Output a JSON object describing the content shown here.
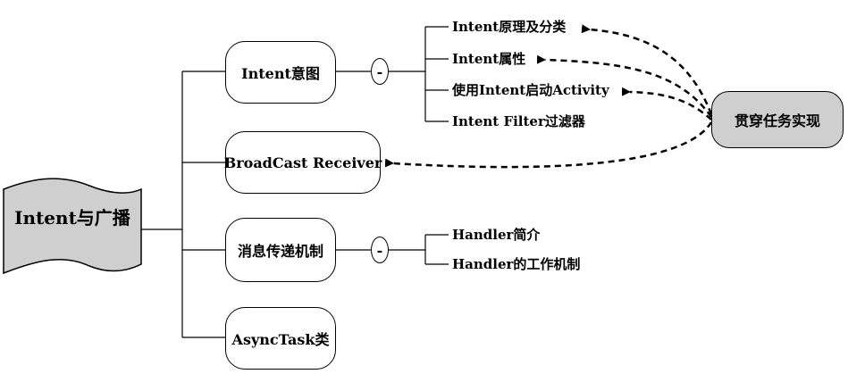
{
  "root": {
    "label": "Intent与广播"
  },
  "branches": [
    {
      "label": "Intent意图",
      "children": [
        "Intent原理及分类",
        "Intent属性",
        "使用Intent启动Activity",
        "Intent Filter过滤器"
      ]
    },
    {
      "label": "BroadCast Receiver"
    },
    {
      "label": "消息传递机制",
      "children": [
        "Handler简介",
        "Handler的工作机制"
      ]
    },
    {
      "label": "AsyncTask类"
    }
  ],
  "collapse_symbol": "-",
  "task_node": {
    "label": "贯穿任务实现"
  }
}
